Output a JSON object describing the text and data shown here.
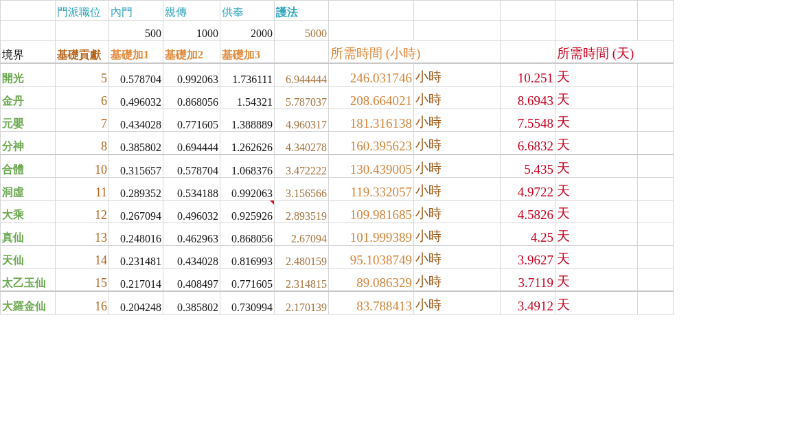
{
  "sheet": {
    "rank_label": "門派職位",
    "ranks": [
      {
        "name": "內門",
        "cost": "500"
      },
      {
        "name": "親傳",
        "cost": "1000"
      },
      {
        "name": "供奉",
        "cost": "2000"
      },
      {
        "name": "護法",
        "cost": "5000"
      }
    ],
    "headers": {
      "realm": "境界",
      "base": "基礎貢獻",
      "adds": [
        "基礎加1",
        "基礎加2",
        "基礎加3"
      ],
      "hours": "所需時間 (小時)",
      "days": "所需時間 (天)"
    },
    "rows": [
      {
        "realm": "開光",
        "base": "5",
        "adds": [
          "0.578704",
          "0.992063",
          "1.736111",
          "6.944444"
        ],
        "hours": "246.031746",
        "hours_unit": "小時",
        "days": "10.251",
        "days_unit": "天",
        "commented": false
      },
      {
        "realm": "金丹",
        "base": "6",
        "adds": [
          "0.496032",
          "0.868056",
          "1.54321",
          "5.787037"
        ],
        "hours": "208.664021",
        "hours_unit": "小時",
        "days": "8.6943",
        "days_unit": "天",
        "commented": false
      },
      {
        "realm": "元嬰",
        "base": "7",
        "adds": [
          "0.434028",
          "0.771605",
          "1.388889",
          "4.960317"
        ],
        "hours": "181.316138",
        "hours_unit": "小時",
        "days": "7.5548",
        "days_unit": "天",
        "commented": false
      },
      {
        "realm": "分神",
        "base": "8",
        "adds": [
          "0.385802",
          "0.694444",
          "1.262626",
          "4.340278"
        ],
        "hours": "160.395623",
        "hours_unit": "小時",
        "days": "6.6832",
        "days_unit": "天",
        "commented": false
      },
      {
        "realm": "合體",
        "base": "10",
        "adds": [
          "0.315657",
          "0.578704",
          "1.068376",
          "3.472222"
        ],
        "hours": "130.439005",
        "hours_unit": "小時",
        "days": "5.435",
        "days_unit": "天",
        "commented": false
      },
      {
        "realm": "洞虛",
        "base": "11",
        "adds": [
          "0.289352",
          "0.534188",
          "0.992063",
          "3.156566"
        ],
        "hours": "119.332057",
        "hours_unit": "小時",
        "days": "4.9722",
        "days_unit": "天",
        "commented": false
      },
      {
        "realm": "大乘",
        "base": "12",
        "adds": [
          "0.267094",
          "0.496032",
          "0.925926",
          "2.893519"
        ],
        "hours": "109.981685",
        "hours_unit": "小時",
        "days": "4.5826",
        "days_unit": "天",
        "commented": true
      },
      {
        "realm": "真仙",
        "base": "13",
        "adds": [
          "0.248016",
          "0.462963",
          "0.868056",
          "2.67094"
        ],
        "hours": "101.999389",
        "hours_unit": "小時",
        "days": "4.25",
        "days_unit": "天",
        "commented": false
      },
      {
        "realm": "天仙",
        "base": "14",
        "adds": [
          "0.231481",
          "0.434028",
          "0.816993",
          "2.480159"
        ],
        "hours": "95.1038749",
        "hours_unit": "小時",
        "days": "3.9627",
        "days_unit": "天",
        "commented": false
      },
      {
        "realm": "太乙玉仙",
        "base": "15",
        "adds": [
          "0.217014",
          "0.408497",
          "0.771605",
          "2.314815"
        ],
        "hours": "89.086329",
        "hours_unit": "小時",
        "days": "3.7119",
        "days_unit": "天",
        "commented": false
      },
      {
        "realm": "大羅金仙",
        "base": "16",
        "adds": [
          "0.204248",
          "0.385802",
          "0.730994",
          "2.170139"
        ],
        "hours": "83.788413",
        "hours_unit": "小時",
        "days": "3.4912",
        "days_unit": "天",
        "commented": false
      }
    ]
  }
}
